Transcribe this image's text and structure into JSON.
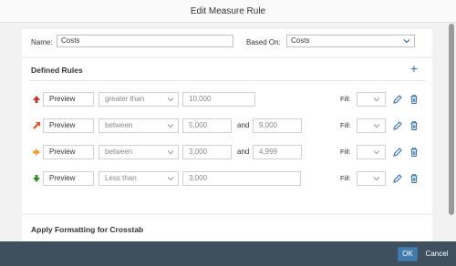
{
  "dialog": {
    "title": "Edit Measure Rule"
  },
  "name_section": {
    "name_label": "Name:",
    "name_value": "Costs",
    "based_on_label": "Based On:",
    "based_on_value": "Costs"
  },
  "defined_rules": {
    "title": "Defined Rules",
    "rules": [
      {
        "arrow": "arrow-up-icon",
        "arrow_color": "#c0392b",
        "preview": "Preview",
        "operator": "greater than",
        "value1": "10,000",
        "and_label": "",
        "value2": "",
        "fill_label": "Fill:"
      },
      {
        "arrow": "arrow-up-right-icon",
        "arrow_color": "#e0542a",
        "preview": "Preview",
        "operator": "between",
        "value1": "5,000",
        "and_label": "and",
        "value2": "9,000",
        "fill_label": "Fill:"
      },
      {
        "arrow": "arrow-right-icon",
        "arrow_color": "#f0a030",
        "preview": "Preview",
        "operator": "between",
        "value1": "3,000",
        "and_label": "and",
        "value2": "4,999",
        "fill_label": "Fill:"
      },
      {
        "arrow": "arrow-down-icon",
        "arrow_color": "#3a8a2e",
        "preview": "Preview",
        "operator": "Less than",
        "value1": "3,000",
        "and_label": "",
        "value2": "",
        "fill_label": "Fill:"
      }
    ]
  },
  "crosstab": {
    "title": "Apply Formatting for Crosstab"
  },
  "footer": {
    "ok_label": "OK",
    "cancel_label": "Cancel"
  },
  "colors": {
    "accent": "#427cac",
    "footer_bg": "#3f4f5d",
    "icon_blue": "#2c6fad"
  }
}
